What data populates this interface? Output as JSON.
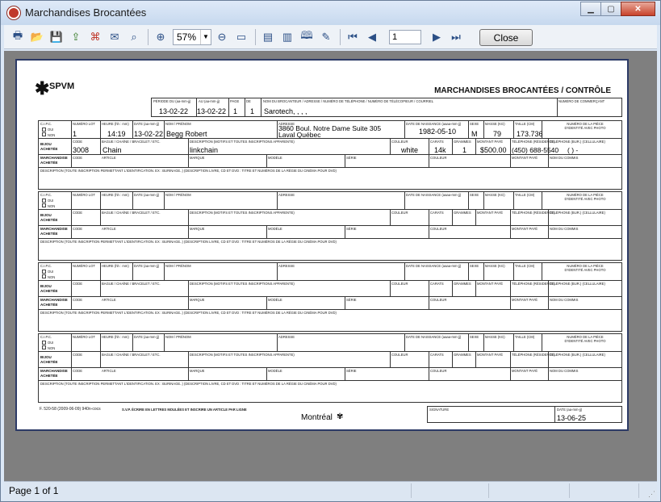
{
  "window": {
    "title": "Marchandises Brocantées"
  },
  "toolbar": {
    "zoom": "57%",
    "page_input": "1",
    "close_label": "Close"
  },
  "form": {
    "logo": "SPVM",
    "title": "MARCHANDISES BROCANTÉES / CONTRÔLE",
    "header": {
      "periode_lbl": "PÉRIODE DU (aa-mm-jj)",
      "periode_val": "13-02-22",
      "au_lbl": "AU (aa-mm-jj)",
      "au_val": "13-02-22",
      "page_lbl": "PAGE",
      "page_val": "1",
      "de_lbl": "DE",
      "de_val": "1",
      "brocanteur_lbl": "NOM DU BROCANTEUR / ADRESSE / NUMÉRO DE TÉLÉPHONE / NUMÉRO DE TÉLÉCOPIEUR / COURRIEL",
      "brocanteur_val": "Sarotech, , , ,",
      "commercant_lbl": "NUMÉRO DE COMMERÇANT"
    },
    "labels": {
      "cipc": "C.I.P.C.",
      "oui": "OUI",
      "non": "NON",
      "lot": "NUMÉRO LOT",
      "heure": "HEURE (hh : mm)",
      "date": "DATE (aa-mm-jj)",
      "nom": "NOM / PRÉNOM",
      "adresse": "ADRESSE",
      "naissance": "DATE DE NAISSANCE (aaaa-mm-jj)",
      "sexe": "SEXE",
      "masse": "MASSE (KG)",
      "taille": "TAILLE (CM)",
      "piece": "NUMÉRO DE LA PIÈCE D'IDENTITÉ AVEC PHOTO",
      "bijou": "BIJOU ACHETÉE",
      "code": "CODE",
      "bague": "BAGUE / CHAÎNE / BRACELET / ETC.",
      "description_motifs": "DESCRIPTION (MOTIFS ET TOUTES INSCRIPTIONS APPARENTE)",
      "couleur": "COULEUR",
      "carats": "CARATS",
      "grammes": "GRAMMES",
      "montant": "MONTANT PAYÉ",
      "tel_res": "TÉLÉPHONE (RÉSIDENCE)",
      "tel_bur": "TÉLÉPHONE (BUR.) (CELLULAIRE)",
      "marchandise": "MARCHANDISE ACHETÉE",
      "article": "ARTICLE",
      "marque": "MARQUE",
      "modele": "MODÈLE",
      "serie": "SÉRIE",
      "commis": "NOM DU COMMIS",
      "desc_long": "DESCRIPTION (TOUTE INSCRIPTION PERMETTANT L'IDENTIFICATION. EX : BURINAGE..) (DESCRIPTION LIVRE, CD ET DVD : TITRE ET NUMÉROS DE LA RÉGIE DU CINÉMA POUR DVD)"
    },
    "entry1": {
      "lot": "1",
      "heure": "14:19",
      "date": "13-02-22",
      "nom": "Begg Robert",
      "adresse_1": "3860 Boul. Notre Dame Suite 305",
      "adresse_2": "Laval Québec",
      "naissance": "1982-05-10",
      "sexe": "M",
      "masse": "79",
      "taille": "173.736",
      "code": "3008",
      "bague": "Chain",
      "description": "linkchain",
      "couleur": "white",
      "carats": "14k",
      "grammes": "1",
      "montant": "$500.00",
      "tel_res": "(450) 688-5540",
      "tel_bur": "(   )  -"
    },
    "footer": {
      "form_no": "F. 520-58 (2009-06-09) 940n-cocs",
      "instruction": "S.V.P. ÉCRIRE EN LETTRES MOULÉES ET INSCRIRE UN ARTICLE PAR LIGNE",
      "brand": "Montréal",
      "signature_lbl": "SIGNATURE",
      "date_lbl": "DATE (aa-mm-jj)",
      "date_val": "13-06-25"
    }
  },
  "status": {
    "page_text": "Page 1 of 1"
  }
}
